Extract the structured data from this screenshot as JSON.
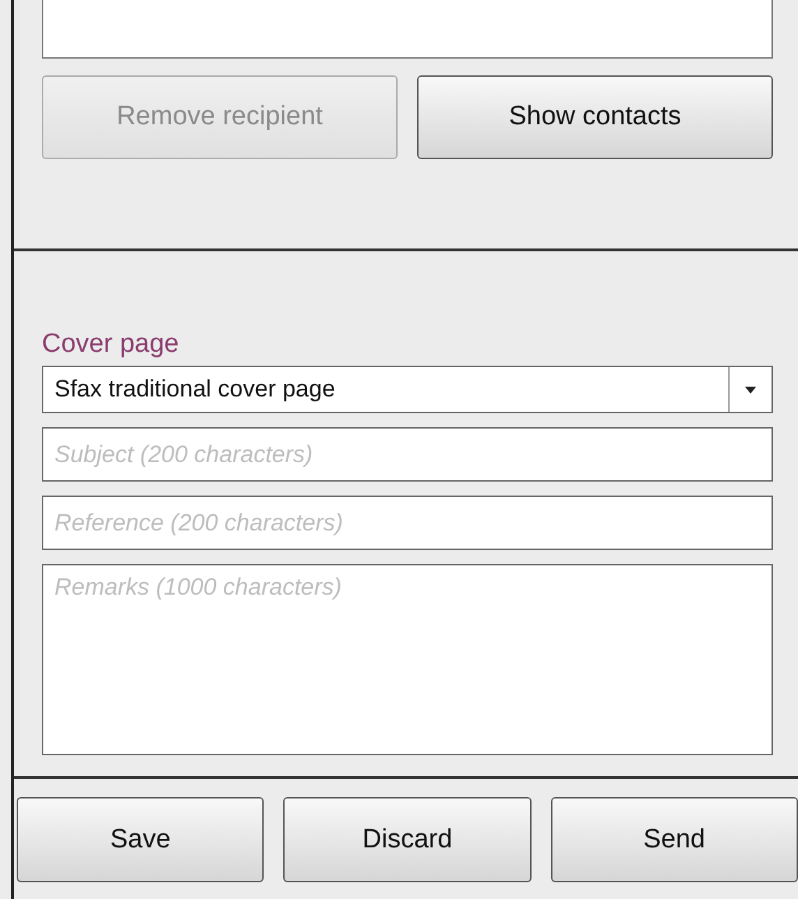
{
  "recipient_buttons": [
    {
      "label": "Remove recipient",
      "disabled": true
    },
    {
      "label": "Show contacts",
      "disabled": false
    }
  ],
  "cover_page": {
    "heading": "Cover page",
    "template": {
      "value": "Sfax traditional cover page"
    },
    "fields": [
      {
        "kind": "line",
        "placeholder": "Subject (200 characters)"
      },
      {
        "kind": "line",
        "placeholder": "Reference (200 characters)"
      },
      {
        "kind": "area",
        "placeholder": "Remarks (1000 characters)"
      }
    ]
  },
  "actions": [
    {
      "label": "Save"
    },
    {
      "label": "Discard"
    },
    {
      "label": "Send"
    }
  ]
}
